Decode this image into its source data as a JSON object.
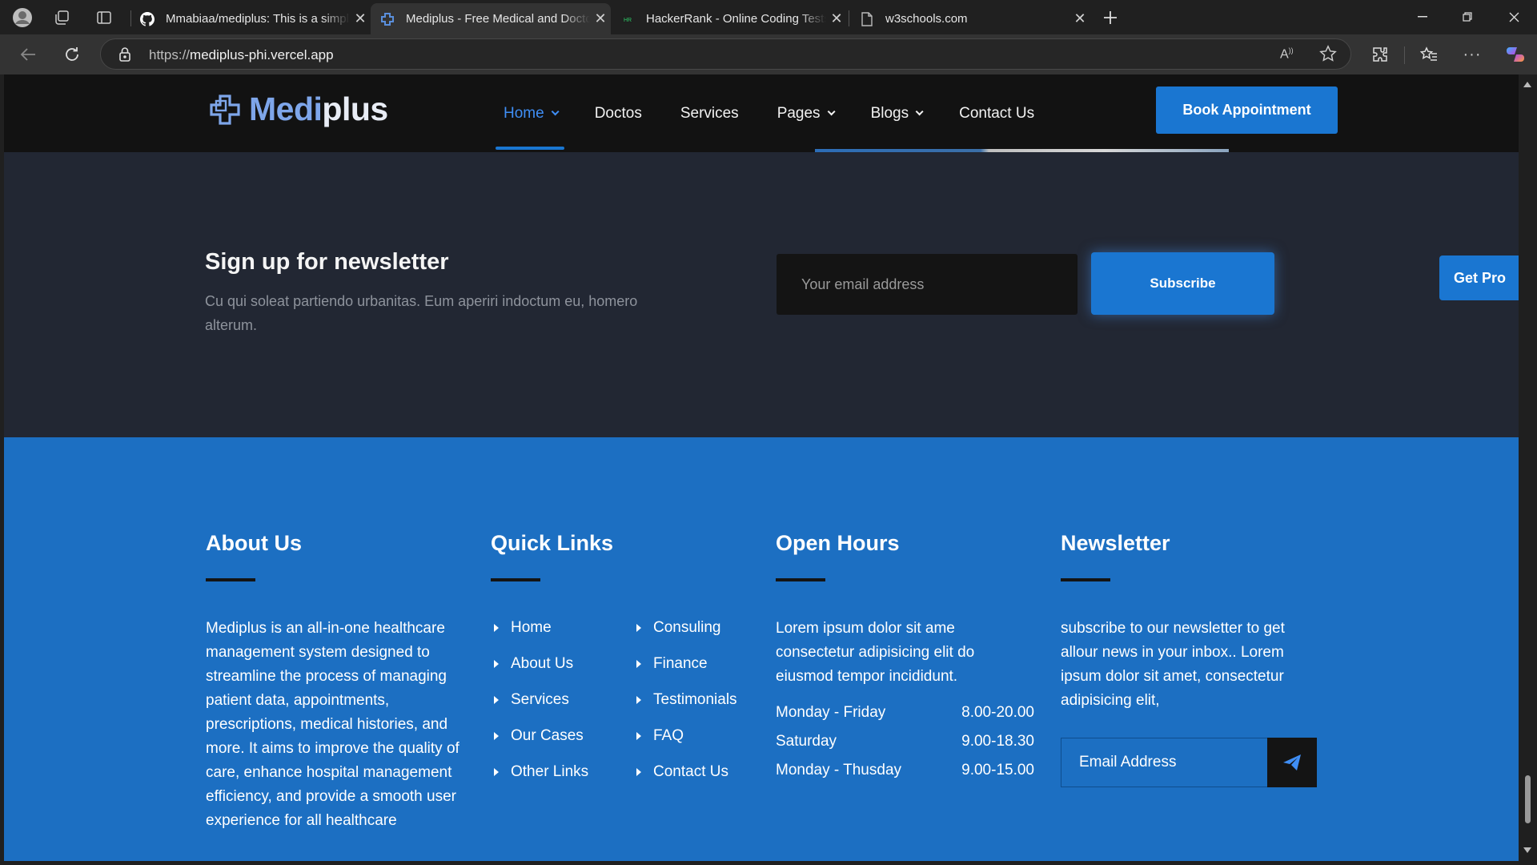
{
  "browser": {
    "tabs": [
      {
        "title": "Mmabiaa/mediplus: This is a simple",
        "icon": "github-icon",
        "active": false
      },
      {
        "title": "Mediplus - Free Medical and Doctor",
        "icon": "mediplus-favicon",
        "active": true
      },
      {
        "title": "HackerRank - Online Coding Tests",
        "icon": "hackerrank-icon",
        "active": false
      },
      {
        "title": "w3schools.com",
        "icon": "page-icon",
        "active": false
      }
    ],
    "url_prefix": "https://",
    "url_host": "mediplus-phi.vercel.app"
  },
  "site": {
    "logo": "Mediplus",
    "nav": [
      "Home",
      "Doctos",
      "Services",
      "Pages",
      "Blogs",
      "Contact Us"
    ],
    "book_button": "Book Appointment"
  },
  "newsletter_band": {
    "title": "Sign up for newsletter",
    "description": "Cu qui soleat partiendo urbanitas. Eum aperiri indoctum eu, homero alterum.",
    "email_placeholder": "Your email address",
    "subscribe": "Subscribe",
    "get_pro": "Get Pro"
  },
  "footer": {
    "about": {
      "title": "About Us",
      "text": "Mediplus is an all-in-one healthcare management system designed to streamline the process of managing patient data, appointments, prescriptions, medical histories, and more. It aims to improve the quality of care, enhance hospital management efficiency, and provide a smooth user experience for all healthcare"
    },
    "quick_links": {
      "title": "Quick Links",
      "col1": [
        "Home",
        "About Us",
        "Services",
        "Our Cases",
        "Other Links"
      ],
      "col2": [
        "Consuling",
        "Finance",
        "Testimonials",
        "FAQ",
        "Contact Us"
      ]
    },
    "open_hours": {
      "title": "Open Hours",
      "text": "Lorem ipsum dolor sit ame consectetur adipisicing elit do eiusmod tempor incididunt.",
      "rows": [
        {
          "day": "Monday - Friday",
          "time": "8.00-20.00"
        },
        {
          "day": "Saturday",
          "time": "9.00-18.30"
        },
        {
          "day": "Monday - Thusday",
          "time": "9.00-15.00"
        }
      ]
    },
    "newsletter": {
      "title": "Newsletter",
      "text": "subscribe to our newsletter to get allour news in your inbox.. Lorem ipsum dolor sit amet, consectetur adipisicing elit,",
      "placeholder": "Email Address"
    }
  }
}
